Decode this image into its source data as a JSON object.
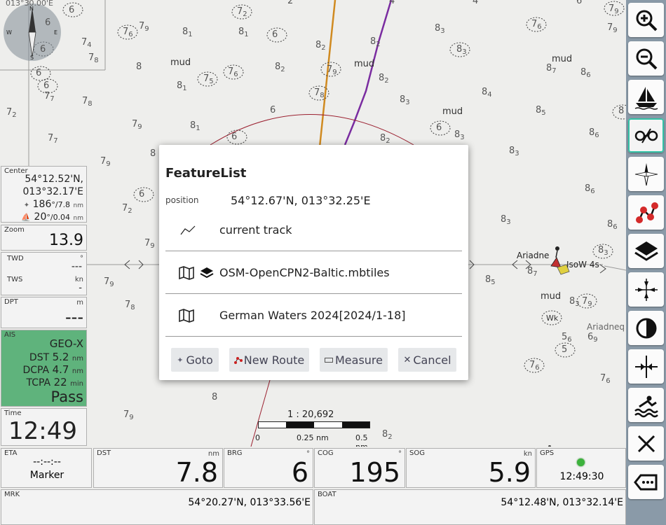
{
  "map": {
    "coord_label": "013°30.00'E",
    "mud_labels": [
      "mud",
      "mud",
      "mud",
      "mud",
      "mud"
    ],
    "names": {
      "ariadne": "Ariadne",
      "isow": "IsoW 4s",
      "ariadne2": "Ariadneq",
      "wk": "Wk"
    },
    "scale": {
      "ratio": "1 : 20,692",
      "t0": "0",
      "t1": "0.25 nm",
      "t2": "0.5 nm"
    }
  },
  "widgets": {
    "center": {
      "label": "Center",
      "lat": "54°12.52'N,",
      "lon": "013°32.17'E",
      "brg_val": "186",
      "brg_unit": "°/7.8",
      "brg_nm": "nm",
      "boat_val": "20",
      "boat_unit": "°/0.04",
      "boat_nm": "nm"
    },
    "zoom": {
      "label": "Zoom",
      "value": "13.9"
    },
    "wind": {
      "twd_label": "TWD",
      "twd_unit": "°",
      "twd_value": "---",
      "tws_label": "TWS",
      "tws_unit": "kn",
      "tws_value": "-"
    },
    "dpt": {
      "label": "DPT",
      "unit": "m",
      "value": "---"
    },
    "ais": {
      "label": "AIS",
      "name": "GEO-X",
      "dst_label": "DST",
      "dst_value": "5.2",
      "dst_unit": "nm",
      "dcpa_label": "DCPA",
      "dcpa_value": "4.7",
      "dcpa_unit": "nm",
      "tcpa_label": "TCPA",
      "tcpa_value": "22",
      "tcpa_unit": "min",
      "status": "Pass"
    },
    "time": {
      "label": "Time",
      "value": "12:49"
    }
  },
  "bottom": {
    "eta": {
      "label": "ETA",
      "value": "--:--:--",
      "sub": "Marker"
    },
    "dst": {
      "label": "DST",
      "unit": "nm",
      "value": "7.8"
    },
    "brg": {
      "label": "BRG",
      "unit": "°",
      "value": "6"
    },
    "cog": {
      "label": "COG",
      "unit": "°",
      "value": "195"
    },
    "sog": {
      "label": "SOG",
      "unit": "kn",
      "value": "5.9"
    },
    "gps": {
      "label": "GPS",
      "time": "12:49:30"
    },
    "mrk": {
      "label": "MRK",
      "value": "54°20.27'N, 013°33.56'E"
    },
    "boat": {
      "label": "BOAT",
      "value": "54°12.48'N, 013°32.14'E"
    }
  },
  "dialog": {
    "title": "FeatureList",
    "position_label": "position",
    "position_value": "54°12.67'N, 013°32.25'E",
    "items": [
      "current track",
      "OSM-OpenCPN2-Baltic.mbtiles",
      "German Waters 2024[2024/1-18]"
    ],
    "buttons": {
      "goto": "Goto",
      "new_route": "New Route",
      "measure": "Measure",
      "cancel": "Cancel"
    }
  },
  "toolbar": [
    "zoom-in-icon",
    "zoom-out-icon",
    "boat-icon",
    "lock-target-icon",
    "compass-icon",
    "route-icon",
    "layers-icon",
    "center-icon",
    "day-night-icon",
    "anchor-point-icon",
    "man-overboard-icon",
    "close-icon",
    "back-icon"
  ]
}
